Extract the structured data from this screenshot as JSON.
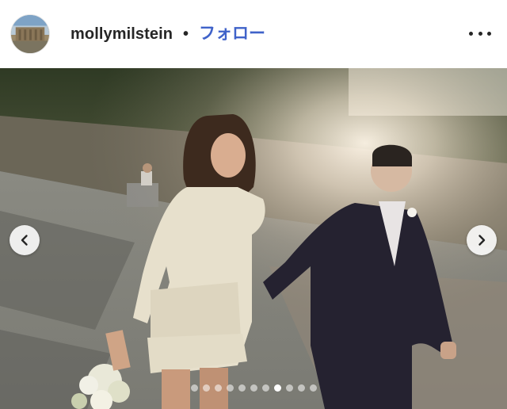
{
  "post": {
    "username": "mollymilstein",
    "separator": "•",
    "follow_label": "フォロー",
    "more_icon": "more-horizontal-icon",
    "avatar_icon": "profile-avatar"
  },
  "carousel": {
    "prev_icon": "chevron-left-icon",
    "next_icon": "chevron-right-icon",
    "total_slides": 11,
    "active_index": 7
  }
}
